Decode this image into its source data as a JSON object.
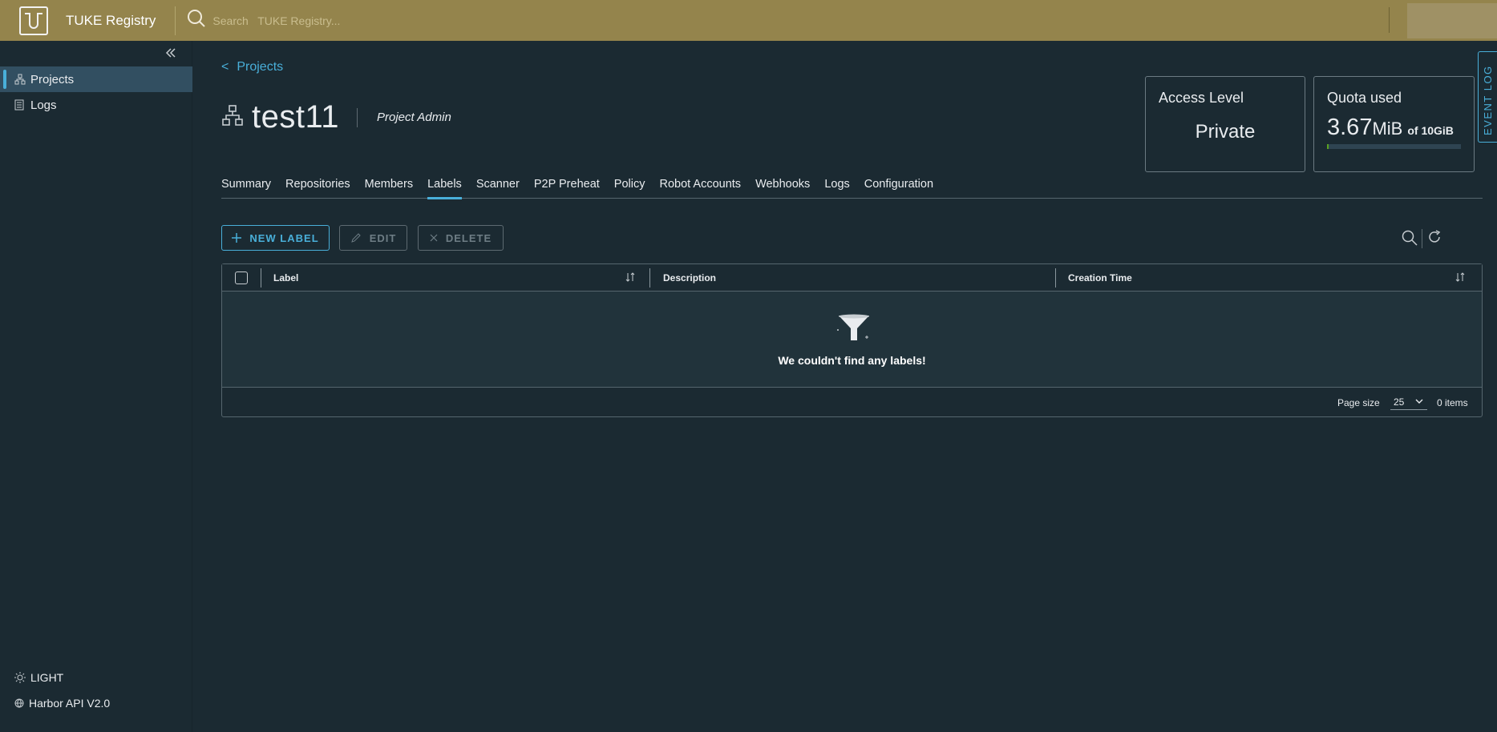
{
  "header": {
    "brand": "TUKE Registry",
    "search_placeholder": "Search   TUKE Registry..."
  },
  "sidebar": {
    "items": [
      {
        "label": "Projects",
        "icon": "projects-icon",
        "active": true
      },
      {
        "label": "Logs",
        "icon": "logs-icon",
        "active": false
      }
    ],
    "theme_toggle": "LIGHT",
    "api_link": "Harbor API V2.0"
  },
  "breadcrumb": {
    "arrow": "<",
    "label": "Projects"
  },
  "project": {
    "name": "test11",
    "role": "Project Admin"
  },
  "access_card": {
    "title": "Access Level",
    "value": "Private"
  },
  "quota_card": {
    "title": "Quota used",
    "value": "3.67",
    "unit": "MiB",
    "of": "of 10GiB",
    "used_fraction": 0.0004
  },
  "event_log": "EVENT LOG",
  "tabs": [
    "Summary",
    "Repositories",
    "Members",
    "Labels",
    "Scanner",
    "P2P Preheat",
    "Policy",
    "Robot Accounts",
    "Webhooks",
    "Logs",
    "Configuration"
  ],
  "active_tab": "Labels",
  "toolbar": {
    "new_label": "NEW LABEL",
    "edit": "EDIT",
    "delete": "DELETE"
  },
  "table": {
    "columns": [
      "Label",
      "Description",
      "Creation Time"
    ],
    "empty_message": "We couldn't find any labels!",
    "page_size_label": "Page size",
    "page_size": "25",
    "items": "0 items"
  },
  "colors": {
    "header_bg": "#94844c",
    "page_bg": "#1b2a32",
    "accent": "#49afd9"
  }
}
